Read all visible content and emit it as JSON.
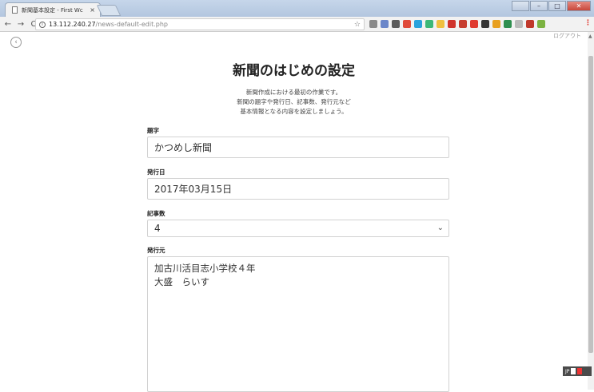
{
  "browser": {
    "tab_title": "新聞基本設定 - First Wc",
    "tab_close": "×",
    "url_host": "13.112.240.27",
    "url_path": "/news-default-edit.php",
    "star": "☆",
    "back": "←",
    "forward": "→",
    "reload": "C",
    "extension_colors": [
      "#8a8a8a",
      "#6b86c9",
      "#5b5b5b",
      "#e04b3b",
      "#2aa2dc",
      "#3cb878",
      "#f0c040",
      "#d0342c",
      "#c63d2f",
      "#e03a30",
      "#333333",
      "#e8a020",
      "#2f8f4f",
      "#bbbbbb",
      "#c0392b",
      "#7cb342"
    ]
  },
  "page": {
    "top_corner_label": "ログアウト",
    "title": "新聞のはじめの設定",
    "intro_lines": [
      "新聞作成における最初の作業です。",
      "新聞の題字や発行日、記事数、発行元など",
      "基本情報となる内容を設定しましょう。"
    ],
    "fields": {
      "title_label": "題字",
      "title_value": "かつめし新聞",
      "date_label": "発行日",
      "date_value": "2017年03月15日",
      "count_label": "記事数",
      "count_value": "4",
      "publisher_label": "発行元",
      "publisher_lines": [
        "加古川活目志小学校４年",
        "大盛　らいす"
      ]
    }
  },
  "taskbar": {
    "ime": "JP"
  }
}
